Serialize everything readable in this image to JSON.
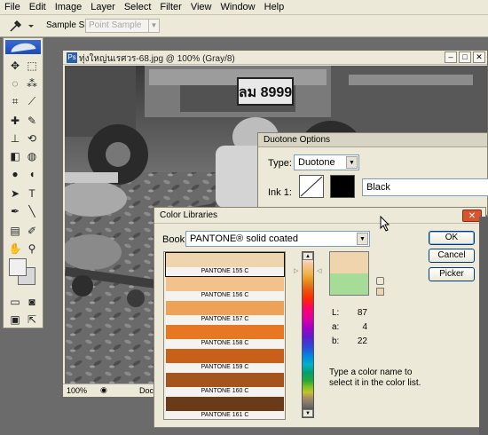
{
  "menu": [
    "File",
    "Edit",
    "Image",
    "Layer",
    "Select",
    "Filter",
    "View",
    "Window",
    "Help"
  ],
  "options_bar": {
    "sample_size_label": "Sample Size:",
    "sample_size_value": "Point Sample"
  },
  "document": {
    "title": "ทุ่งใหญ่นเรศวร-68.jpg @ 100% (Gray/8)",
    "plate_text": "ลม 8999",
    "zoom": "100%",
    "doc_label": "Doc:"
  },
  "duotone": {
    "title": "Duotone Options",
    "type_label": "Type:",
    "type_value": "Duotone",
    "ink1_label": "Ink 1:",
    "ink1_name": "Black",
    "ink1_color": "#000000"
  },
  "color_libraries": {
    "title": "Color Libraries",
    "book_label": "Book:",
    "book_value": "PANTONE® solid coated",
    "swatches": [
      {
        "name": "PANTONE 155 C",
        "color": "#efd5ad"
      },
      {
        "name": "PANTONE 156 C",
        "color": "#f3c28c"
      },
      {
        "name": "PANTONE 157 C",
        "color": "#eda257"
      },
      {
        "name": "PANTONE 158 C",
        "color": "#e77723"
      },
      {
        "name": "PANTONE 159 C",
        "color": "#c8601a"
      },
      {
        "name": "PANTONE 160 C",
        "color": "#a4541c"
      },
      {
        "name": "PANTONE 161 C",
        "color": "#6b3a18"
      }
    ],
    "preview_old_color": "#efd5ad",
    "preview_new_color": "#a6dc97",
    "L_label": "L:",
    "L_value": "87",
    "a_label": "a:",
    "a_value": "4",
    "b_label": "b:",
    "b_value": "22",
    "hint": "Type a color name to select it in the color list.",
    "ok_label": "OK",
    "cancel_label": "Cancel",
    "picker_label": "Picker",
    "close_label": "✕"
  }
}
